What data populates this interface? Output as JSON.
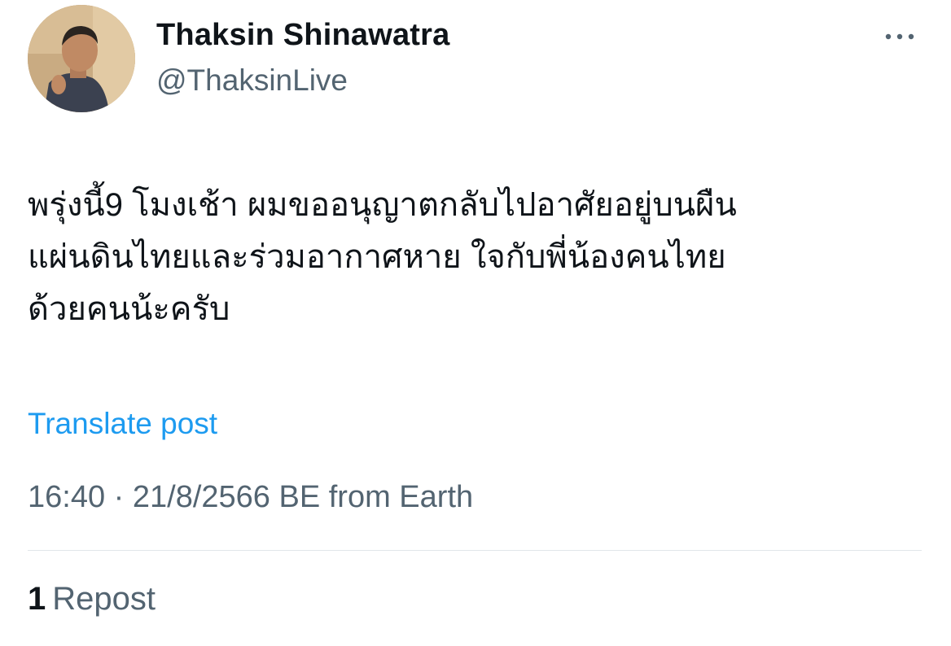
{
  "author": {
    "display_name": "Thaksin Shinawatra",
    "handle": "@ThaksinLive",
    "avatar_icon": "profile-photo"
  },
  "post": {
    "text_lines": [
      "พรุ่งนี้9 โมงเช้า ผมขออนุญาตกลับไปอาศัยอยู่บนผืน",
      "แผ่นดินไทยและร่วมอากาศหาย ใจกับพี่น้องคนไทย",
      "ด้วยคนน้ะครับ"
    ],
    "translate_label": "Translate post",
    "time": "16:40",
    "separator": "·",
    "date": "21/8/2566 BE",
    "source": "from Earth"
  },
  "stats": {
    "repost_count": "1",
    "repost_label": "Repost"
  },
  "colors": {
    "link": "#1d9bf0",
    "secondary_text": "#536471",
    "primary_text": "#0f1419",
    "divider": "#e1e6ea"
  },
  "icons": {
    "more": "more-horizontal-icon"
  }
}
